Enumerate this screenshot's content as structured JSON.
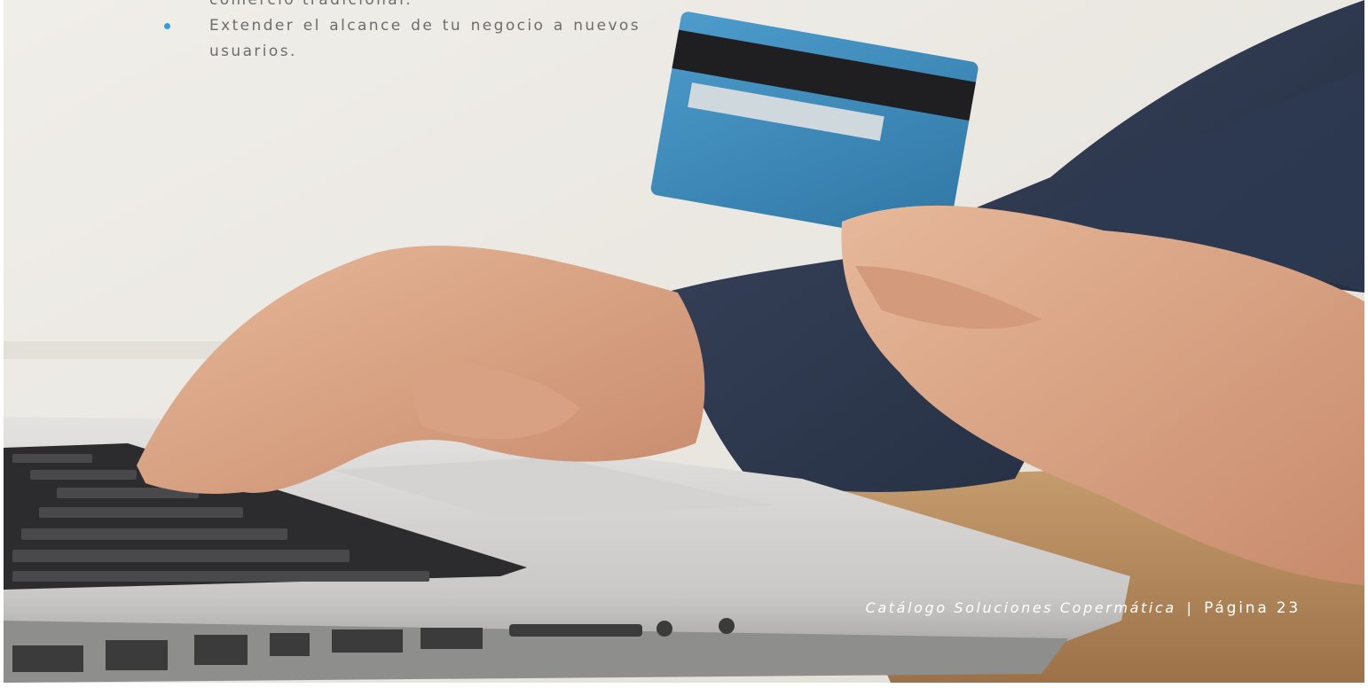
{
  "bullets": [
    {
      "text": "comercio tradicional."
    },
    {
      "text": "Extender el alcance de tu negocio a nuevos usuarios."
    }
  ],
  "footer": {
    "catalog": "Catálogo Soluciones Copermática",
    "separator": "|",
    "page": "Página 23"
  },
  "colors": {
    "bullet": "#2f9fd6",
    "body_text": "#6d6d6d",
    "card": "#3f8fc0",
    "sweater": "#2c3850"
  },
  "image": {
    "subject": "hands typing on a laptop keyboard while holding a blue credit card"
  }
}
